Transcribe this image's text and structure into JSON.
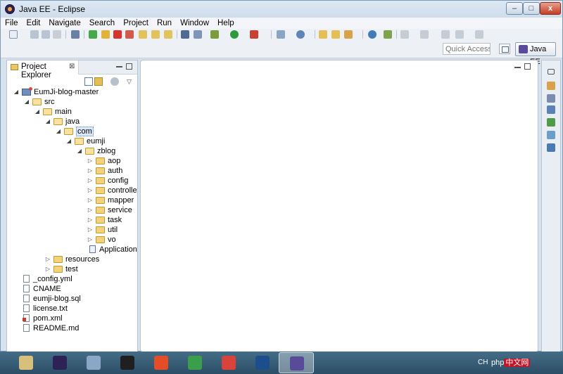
{
  "window": {
    "title": "Java EE - Eclipse",
    "min": "–",
    "max": "□",
    "close": "x"
  },
  "menu": [
    "File",
    "Edit",
    "Navigate",
    "Search",
    "Project",
    "Run",
    "Window",
    "Help"
  ],
  "quick_access": {
    "placeholder": "Quick Access"
  },
  "perspective": {
    "label": "Java EE"
  },
  "explorer": {
    "title": "Project Explorer",
    "close": "⊠",
    "tree": [
      {
        "label": "EumJi-blog-master",
        "depth": 0,
        "type": "project",
        "expanded": true
      },
      {
        "label": "src",
        "depth": 1,
        "type": "folder",
        "expanded": true
      },
      {
        "label": "main",
        "depth": 2,
        "type": "folder",
        "expanded": true
      },
      {
        "label": "java",
        "depth": 3,
        "type": "folder",
        "expanded": true
      },
      {
        "label": "com",
        "depth": 4,
        "type": "folder",
        "expanded": true,
        "selected": true
      },
      {
        "label": "eumji",
        "depth": 5,
        "type": "folder",
        "expanded": true
      },
      {
        "label": "zblog",
        "depth": 6,
        "type": "folder",
        "expanded": true
      },
      {
        "label": "aop",
        "depth": 7,
        "type": "folder",
        "expanded": false
      },
      {
        "label": "auth",
        "depth": 7,
        "type": "folder",
        "expanded": false
      },
      {
        "label": "config",
        "depth": 7,
        "type": "folder",
        "expanded": false
      },
      {
        "label": "controller",
        "depth": 7,
        "type": "folder",
        "expanded": false
      },
      {
        "label": "mapper",
        "depth": 7,
        "type": "folder",
        "expanded": false
      },
      {
        "label": "service",
        "depth": 7,
        "type": "folder",
        "expanded": false
      },
      {
        "label": "task",
        "depth": 7,
        "type": "folder",
        "expanded": false
      },
      {
        "label": "util",
        "depth": 7,
        "type": "folder",
        "expanded": false
      },
      {
        "label": "vo",
        "depth": 7,
        "type": "folder",
        "expanded": false
      },
      {
        "label": "Application",
        "depth": 7,
        "type": "java",
        "leaf": true
      },
      {
        "label": "resources",
        "depth": 3,
        "type": "folder",
        "expanded": false
      },
      {
        "label": "test",
        "depth": 3,
        "type": "folder",
        "expanded": false
      },
      {
        "label": "_config.yml",
        "depth": 1,
        "type": "file",
        "leaf": true
      },
      {
        "label": "CNAME",
        "depth": 1,
        "type": "file",
        "leaf": true
      },
      {
        "label": "eumji-blog.sql",
        "depth": 1,
        "type": "file",
        "leaf": true
      },
      {
        "label": "license.txt",
        "depth": 1,
        "type": "file",
        "leaf": true
      },
      {
        "label": "pom.xml",
        "depth": 1,
        "type": "xml",
        "leaf": true
      },
      {
        "label": "README.md",
        "depth": 1,
        "type": "file",
        "leaf": true
      }
    ]
  },
  "taskbar": {
    "apps": [
      {
        "name": "geany-icon",
        "color": "#d8c07a"
      },
      {
        "name": "eclipse-icon",
        "color": "#2c2255"
      },
      {
        "name": "network-icon",
        "color": "#8aa7c8"
      },
      {
        "name": "pycharm-icon",
        "color": "#1f1f1f"
      },
      {
        "name": "html-icon",
        "color": "#e44d26"
      },
      {
        "name": "chrome-icon",
        "color": "#3a9f4a"
      },
      {
        "name": "swirl-icon",
        "color": "#d9433a"
      },
      {
        "name": "virtualbox-icon",
        "color": "#1d4e8c"
      },
      {
        "name": "javaee-eclipse-icon",
        "color": "#5a4a9a",
        "active": true
      }
    ],
    "lang": "CH",
    "watermark_a": "php",
    "watermark_b": "中文网"
  }
}
